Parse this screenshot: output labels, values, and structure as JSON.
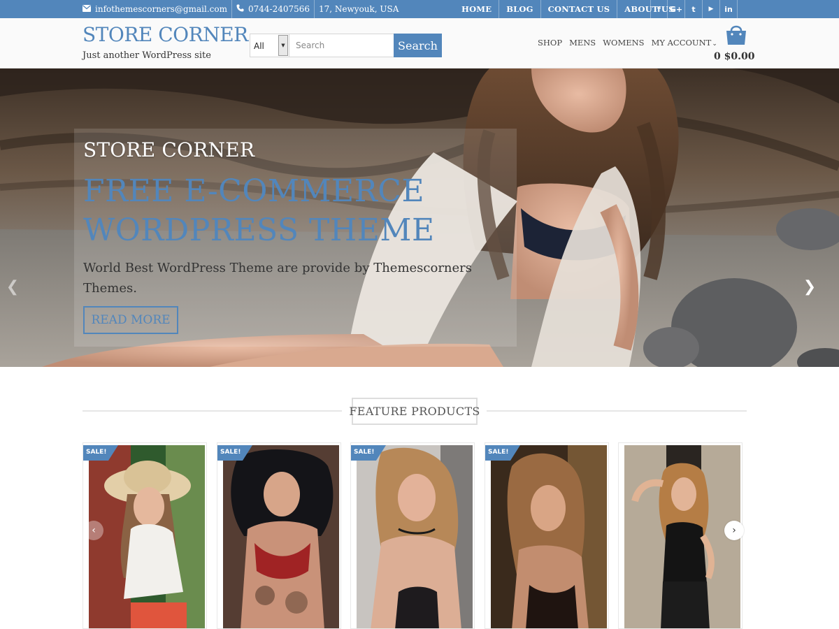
{
  "topbar": {
    "email": "infothemescorners@gmail.com",
    "phone": "0744-2407566",
    "address": "17, Newyouk, USA",
    "nav": [
      "HOME",
      "BLOG",
      "CONTACT US",
      "ABOUT US"
    ],
    "social": [
      {
        "icon": "facebook-icon",
        "glyph": "f"
      },
      {
        "icon": "google-plus-icon",
        "glyph": "G+"
      },
      {
        "icon": "twitter-icon",
        "glyph": "t"
      },
      {
        "icon": "youtube-icon",
        "glyph": "▶"
      },
      {
        "icon": "linkedin-icon",
        "glyph": "in"
      }
    ]
  },
  "header": {
    "site_title": "STORE CORNER",
    "tagline": "Just another WordPress site",
    "search": {
      "category": "All",
      "placeholder": "Search",
      "button": "Search"
    },
    "nav": [
      "SHOP",
      "MENS",
      "WOMENS",
      "MY ACCOUNT"
    ],
    "cart_total": "0 $0.00"
  },
  "hero": {
    "kicker": "STORE CORNER",
    "title": "FREE E-COMMERCE WORDPRESS THEME",
    "text": "World Best WordPress Theme are provide by Themescorners Themes.",
    "cta": "READ MORE",
    "prev_glyph": "❮",
    "next_glyph": "❯"
  },
  "products": {
    "title": "FEATURE PRODUCTS",
    "sale_label": "SALE!",
    "prev_glyph": "‹",
    "next_glyph": "›"
  },
  "colors": {
    "accent": "#5286bb",
    "topbar": "#5286bb"
  }
}
